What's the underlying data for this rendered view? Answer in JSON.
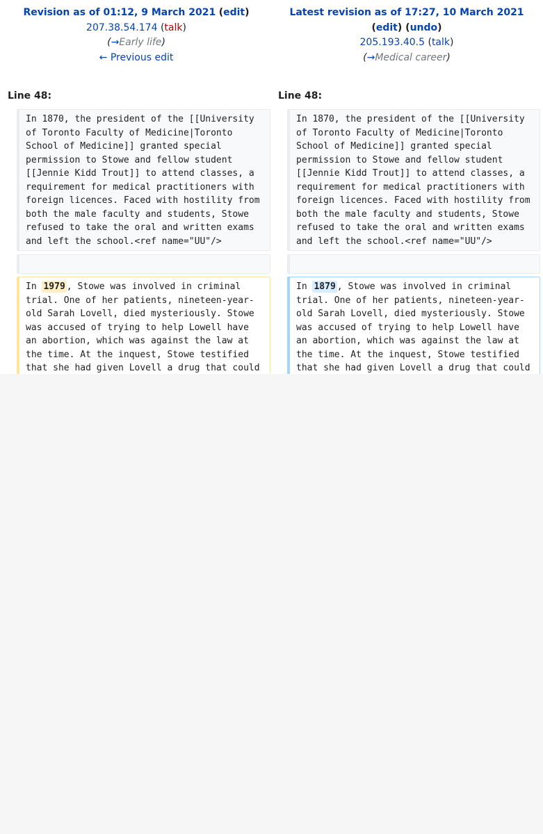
{
  "left_header": {
    "title": "Revision as of 01:12, 9 March 2021",
    "open_paren": "(",
    "edit": "edit",
    "close_paren": ")",
    "user": "207.38.54.174",
    "user_open": "(",
    "talk": "talk",
    "user_close": ")",
    "summary_open": "(",
    "summary_arrow": "→",
    "summary": "Early life",
    "summary_close": ")",
    "prev_edit": "← Previous edit"
  },
  "right_header": {
    "title": "Latest revision as of 17:27, 10 March 2021",
    "edit_open": "(",
    "edit": "edit",
    "edit_close": ")",
    "undo_open": "(",
    "undo": "undo",
    "undo_close": ")",
    "user": "205.193.40.5",
    "user_open": "(",
    "talk": "talk",
    "user_close": ")",
    "summary_open": "(",
    "summary_arrow": "→",
    "summary": "Medical career",
    "summary_close": ")"
  },
  "line_numbers": {
    "left": "Line 48:",
    "right": "Line 48:"
  },
  "context_text": "In 1870, the president of the [[University of Toronto Faculty of Medicine|Toronto School of Medicine]] granted special permission to Stowe and fellow student [[Jennie Kidd Trout]] to attend classes, a requirement for medical practitioners with foreign licences. Faced with hostility from both the male faculty and students, Stowe refused to take the oral and written exams and left the school.<ref name=\"UU\"/>",
  "changed": {
    "prefix": "In ",
    "old_value": "1979",
    "new_value": "1879",
    "suffix": ", Stowe was involved in criminal trial. One of her patients, nineteen-year-old Sarah Lovell, died mysteriously. Stowe was accused of trying to help Lowell have an abortion, which was against the law at the time. At the inquest, Stowe testified that she had given Lovell a drug that could cause"
  }
}
